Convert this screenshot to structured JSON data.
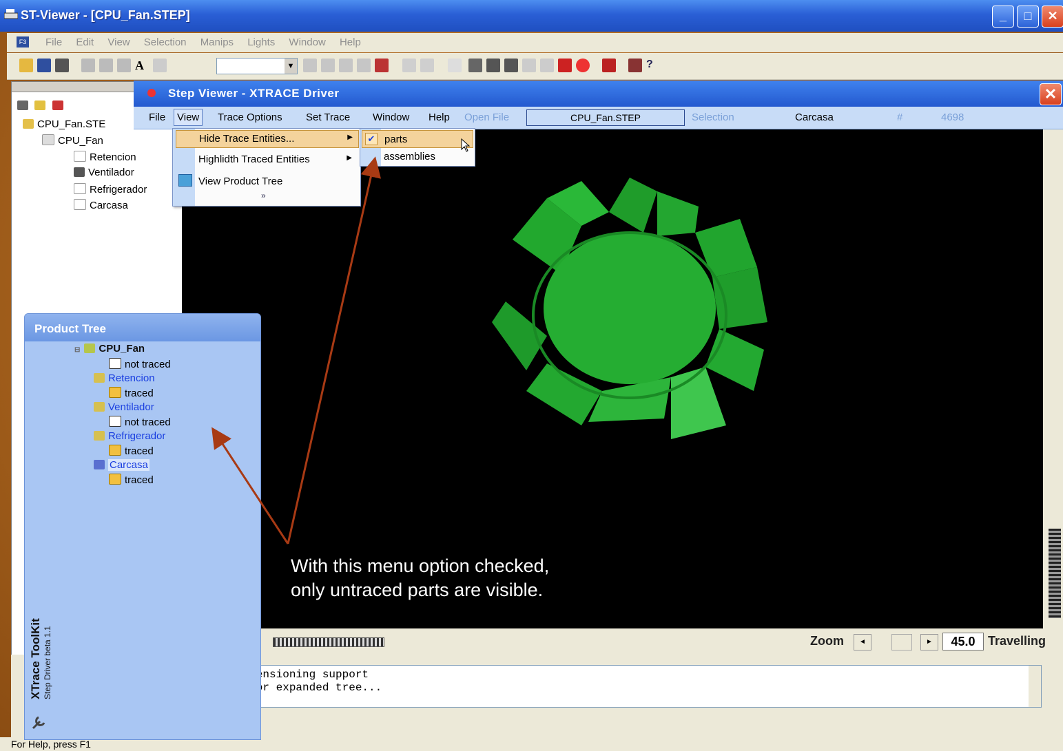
{
  "outer_window": {
    "title": "ST-Viewer - [CPU_Fan.STEP]",
    "menu": [
      "File",
      "Edit",
      "View",
      "Selection",
      "Manips",
      "Lights",
      "Window",
      "Help"
    ]
  },
  "left_tree": {
    "items": [
      {
        "label": "CPU_Fan.STE"
      },
      {
        "label": "CPU_Fan"
      },
      {
        "label": "Retencion"
      },
      {
        "label": "Ventilador"
      },
      {
        "label": "Refrigerador"
      },
      {
        "label": "Carcasa"
      }
    ]
  },
  "inner_window": {
    "title": "Step Viewer - XTRACE Driver",
    "menu": {
      "file": "File",
      "view": "View",
      "trace_options": "Trace Options",
      "set_trace": "Set Trace",
      "window": "Window",
      "help": "Help",
      "open_file_label": "Open File",
      "open_file_value": "CPU_Fan.STEP",
      "selection_label": "Selection",
      "selection_value": "Carcasa",
      "count_label": "#",
      "count_value": "4698"
    }
  },
  "view_menu": {
    "items": [
      {
        "label": "Hide Trace Entities..."
      },
      {
        "label": "Highlidth Traced Entities"
      },
      {
        "label": "View Product Tree"
      }
    ],
    "more": "»"
  },
  "submenu": {
    "items": [
      {
        "label": "parts",
        "checked": true
      },
      {
        "label": "assemblies",
        "checked": false
      }
    ]
  },
  "product_tree": {
    "title": "Product Tree",
    "side_title": "XTrace ToolKit",
    "side_subtitle": "Step Driver beta 1.1",
    "nodes": [
      {
        "label": "CPU_Fan",
        "status": "not traced"
      },
      {
        "label": "Retencion",
        "status": "traced"
      },
      {
        "label": "Ventilador",
        "status": "not traced"
      },
      {
        "label": "Refrigerador",
        "status": "traced"
      },
      {
        "label": "Carcasa",
        "status": "traced"
      }
    ]
  },
  "zoom": {
    "label": "Zoom",
    "value": "45.0",
    "travelling": "Travelling"
  },
  "console": {
    "lines": [
      "dimensioning support",
      "e for expanded tree..."
    ]
  },
  "status_bar": {
    "text": "For Help, press F1"
  },
  "callout": {
    "text": "With this menu  option checked, only untraced parts are visible."
  },
  "colors": {
    "viewport": "#000000",
    "fan": "#22b030",
    "arrow": "#a83a14",
    "titlebar": "#2a5fd6"
  }
}
